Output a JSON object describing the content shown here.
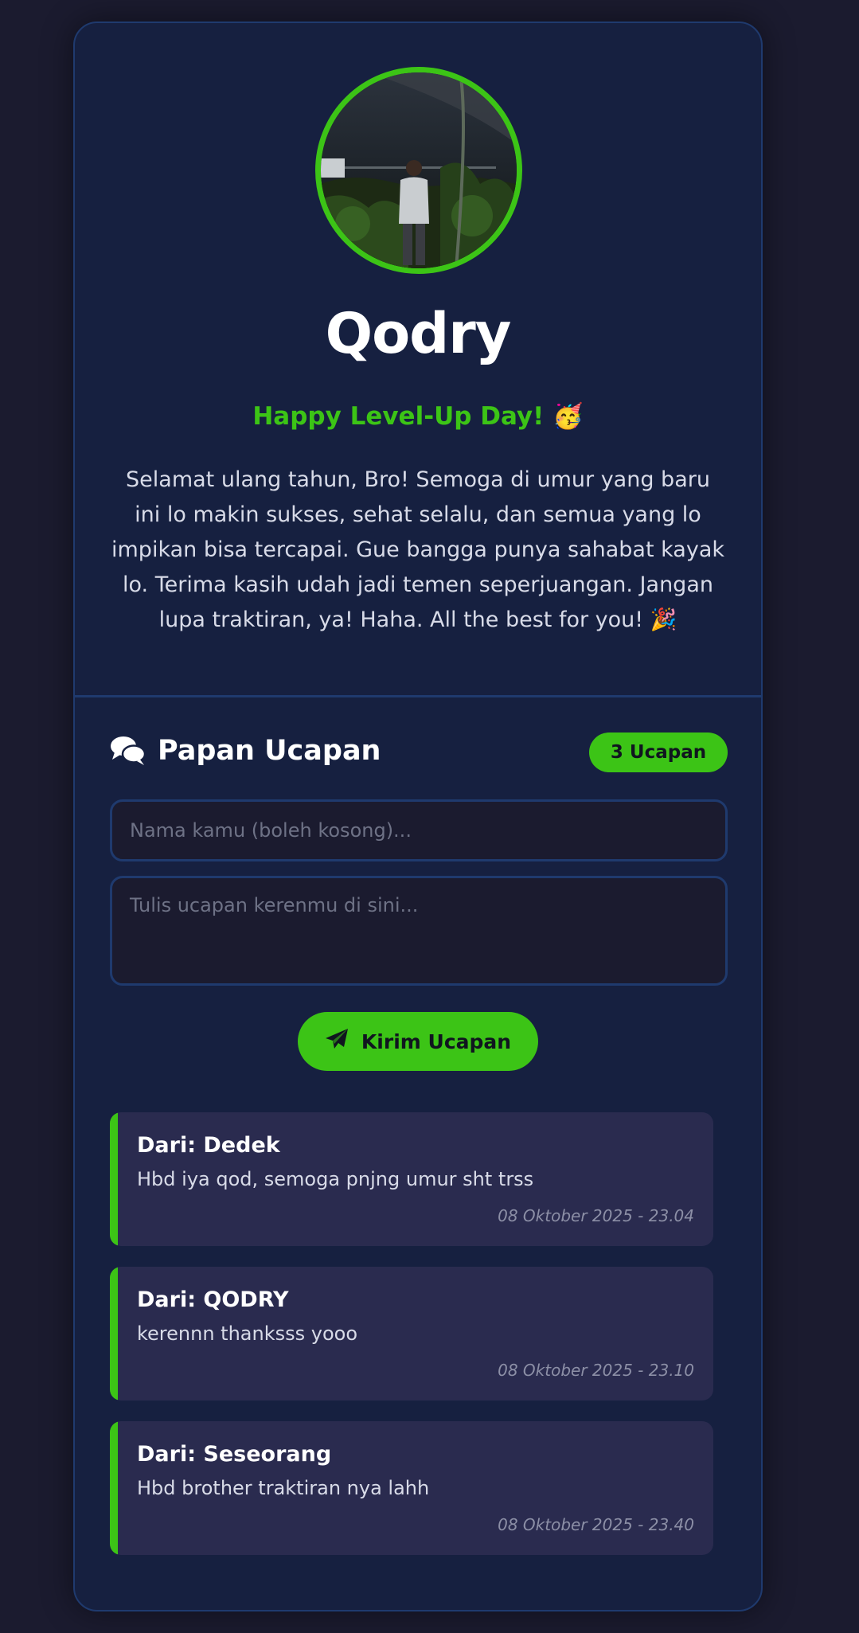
{
  "profile": {
    "name": "Qodry",
    "subtitle": "Happy Level-Up Day! 🥳",
    "message": "Selamat ulang tahun, Bro! Semoga di umur yang baru ini lo makin sukses, sehat selalu, dan semua yang lo impikan bisa tercapai. Gue bangga punya sahabat kayak lo. Terima kasih udah jadi temen seperjuangan. Jangan lupa traktiran, ya! Haha. All the best for you! 🎉"
  },
  "board": {
    "icon": "comments-icon",
    "title": "Papan Ucapan",
    "count_badge": "3 Ucapan",
    "name_placeholder": "Nama kamu (boleh kosong)...",
    "message_placeholder": "Tulis ucapan kerenmu di sini...",
    "send_icon": "paper-plane-icon",
    "send_label": "Kirim Ucapan"
  },
  "wishes": [
    {
      "from": "Dari: Dedek",
      "text": "Hbd iya qod, semoga pnjng umur sht trss",
      "time": "08 Oktober 2025 - 23.04"
    },
    {
      "from": "Dari: QODRY",
      "text": "kerennn thanksss yooo",
      "time": "08 Oktober 2025 - 23.10"
    },
    {
      "from": "Dari: Seseorang",
      "text": "Hbd brother traktiran nya lahh",
      "time": "08 Oktober 2025 - 23.40"
    }
  ],
  "colors": {
    "background": "#1b1b2f",
    "card": "#162040",
    "card_border": "#1f3a6e",
    "accent": "#3cc416",
    "wish_card": "#2a2b4f"
  }
}
